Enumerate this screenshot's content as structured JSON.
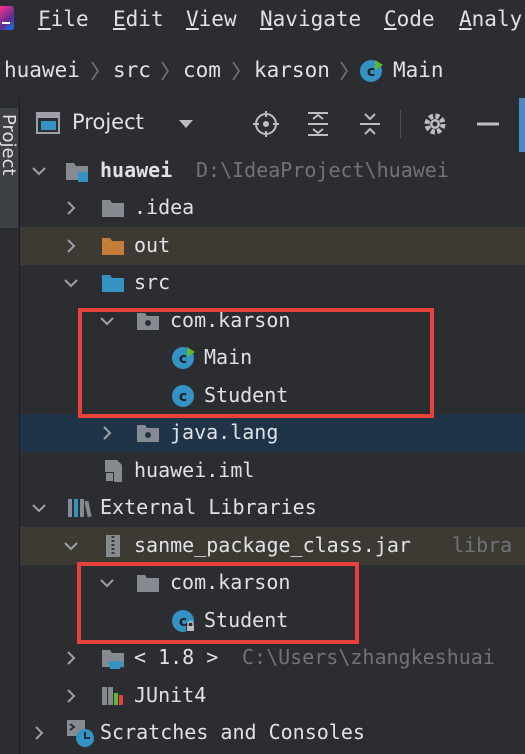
{
  "menu": {
    "file": "File",
    "edit": "Edit",
    "view": "View",
    "navigate": "Navigate",
    "code": "Code",
    "analyze": "Analy"
  },
  "breadcrumb": [
    "huawei",
    "src",
    "com",
    "karson",
    "Main"
  ],
  "sidebar": {
    "project_tab": "Project"
  },
  "toolwindow": {
    "title": "Project"
  },
  "tree": {
    "root": {
      "label": "huawei",
      "path": "D:\\IdeaProject\\huawei"
    },
    "idea": ".idea",
    "out": "out",
    "src": "src",
    "pkg1": "com.karson",
    "main": "Main",
    "student1": "Student",
    "javalang": "java.lang",
    "iml": "huawei.iml",
    "extlibs": "External Libraries",
    "jar": {
      "label": "sanme_package_class.jar",
      "suffix": "libra"
    },
    "pkg2": "com.karson",
    "student2": "Student",
    "jdk": {
      "label": "< 1.8 >",
      "path": "C:\\Users\\zhangkeshuai"
    },
    "junit": "JUnit4",
    "scratches": "Scratches and Consoles"
  },
  "colors": {
    "accent": "#e8403a",
    "folder": "#868a91",
    "out_folder": "#c77d3a",
    "src_folder": "#3592c4",
    "class": "#3592c4"
  }
}
